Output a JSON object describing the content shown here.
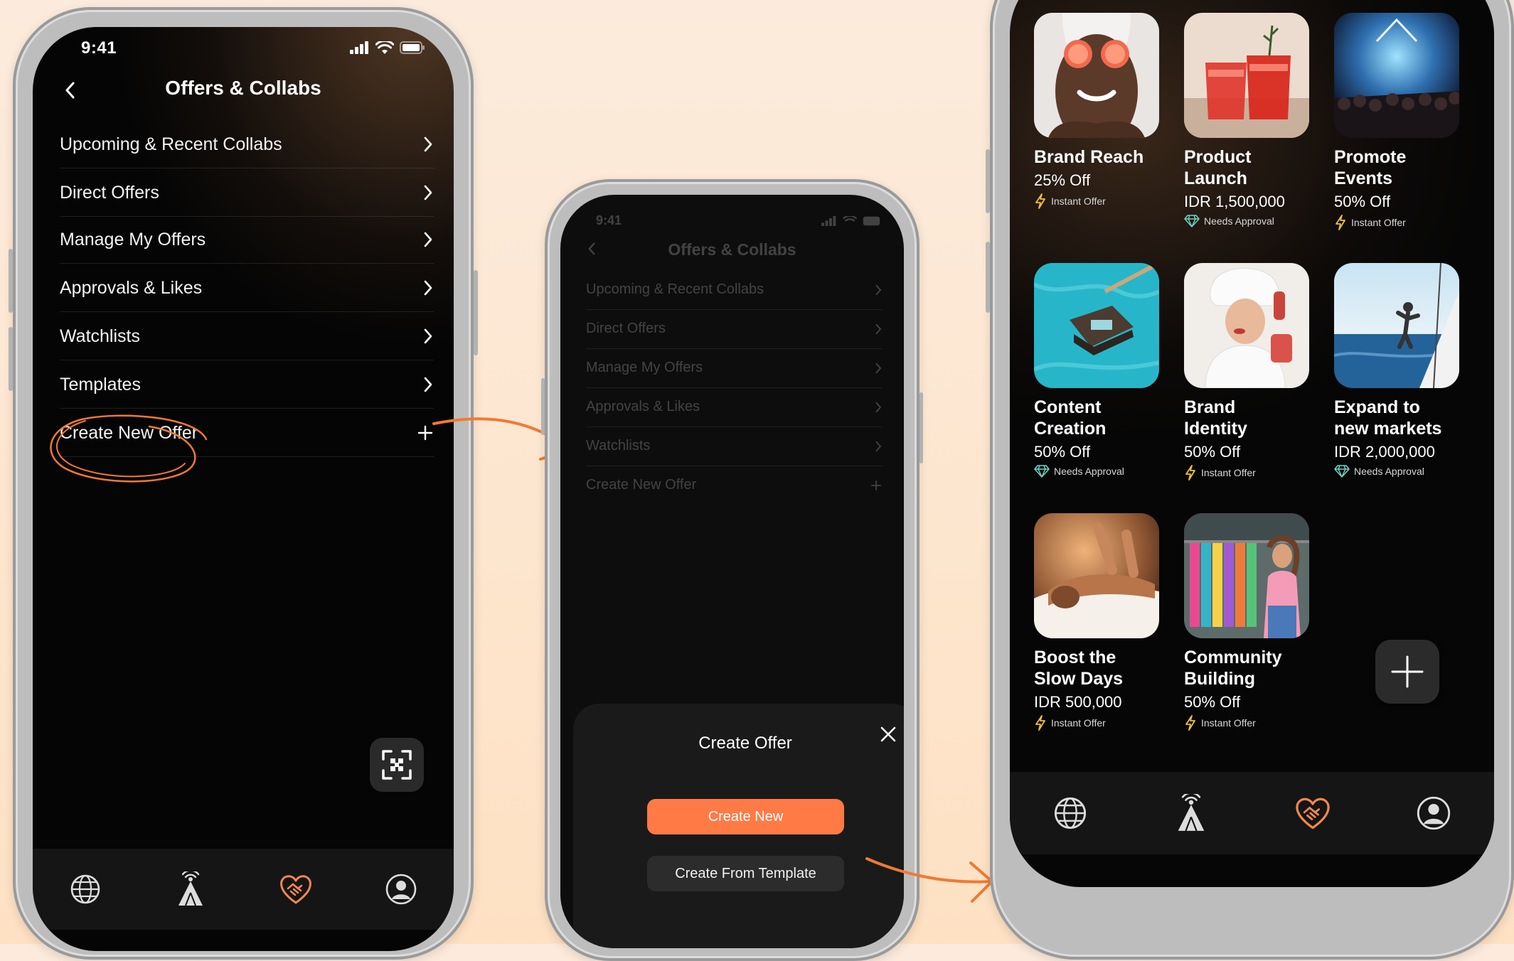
{
  "colors": {
    "accent": "#ff7a45",
    "annotation": "#f07a32",
    "tab_active": "#f2874f"
  },
  "phone1": {
    "status_time": "9:41",
    "title": "Offers & Collabs",
    "menu": [
      {
        "label": "Upcoming & Recent Collabs",
        "icon": "chevron-right-icon"
      },
      {
        "label": "Direct Offers",
        "icon": "chevron-right-icon"
      },
      {
        "label": "Manage My Offers",
        "icon": "chevron-right-icon"
      },
      {
        "label": "Approvals & Likes",
        "icon": "chevron-right-icon"
      },
      {
        "label": "Watchlists",
        "icon": "chevron-right-icon"
      },
      {
        "label": "Templates",
        "icon": "chevron-right-icon"
      },
      {
        "label": "Create New Offer",
        "icon": "plus-icon"
      }
    ],
    "tabs": [
      "globe-icon",
      "broadcast-tower-icon",
      "handshake-heart-icon",
      "user-profile-icon"
    ],
    "active_tab": "handshake-heart-icon"
  },
  "phone2": {
    "status_time": "9:41",
    "title": "Offers & Collabs",
    "menu": [
      "Upcoming & Recent Collabs",
      "Direct Offers",
      "Manage My Offers",
      "Approvals & Likes",
      "Watchlists",
      "Create New Offer"
    ],
    "sheet": {
      "title": "Create Offer",
      "primary": "Create New",
      "secondary": "Create From Template"
    }
  },
  "phone3": {
    "offers": [
      {
        "title_1": "Brand Reach",
        "title_2": "",
        "price": "25% Off",
        "badge": "Instant Offer",
        "badge_icon": "lightning-icon"
      },
      {
        "title_1": "Product",
        "title_2": "Launch",
        "price": "IDR 1,500,000",
        "badge": "Needs Approval",
        "badge_icon": "diamond-icon"
      },
      {
        "title_1": "Promote",
        "title_2": "Events",
        "price": "50% Off",
        "badge": "Instant Offer",
        "badge_icon": "lightning-icon"
      },
      {
        "title_1": "Content",
        "title_2": "Creation",
        "price": "50% Off",
        "badge": "Needs Approval",
        "badge_icon": "diamond-icon"
      },
      {
        "title_1": "Brand",
        "title_2": "Identity",
        "price": "50% Off",
        "badge": "Instant Offer",
        "badge_icon": "lightning-icon"
      },
      {
        "title_1": "Expand to",
        "title_2": "new markets",
        "price": "IDR 2,000,000",
        "badge": "Needs Approval",
        "badge_icon": "diamond-icon"
      },
      {
        "title_1": "Boost the",
        "title_2": "Slow Days",
        "price": "IDR 500,000",
        "badge": "Instant Offer",
        "badge_icon": "lightning-icon"
      },
      {
        "title_1": "Community",
        "title_2": "Building",
        "price": "50% Off",
        "badge": "Instant Offer",
        "badge_icon": "lightning-icon"
      }
    ],
    "fab_icon": "plus-icon",
    "tabs": [
      "globe-icon",
      "broadcast-tower-icon",
      "handshake-heart-icon",
      "user-profile-icon"
    ]
  }
}
